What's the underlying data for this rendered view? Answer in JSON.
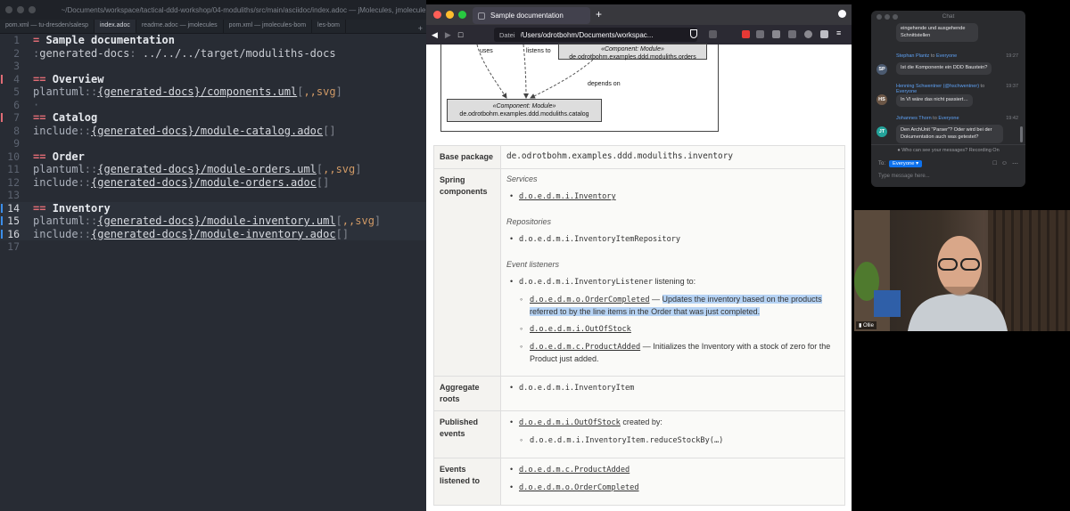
{
  "editor": {
    "window_title": "~/Documents/workspace/tactical-ddd-workshop/04-moduliths/src/main/asciidoc/index.adoc — jMolecules, jmolecule...",
    "tabs": [
      {
        "label": "pom.xml — tu-dresden/salesp",
        "active": false
      },
      {
        "label": "index.adoc",
        "active": true
      },
      {
        "label": "readme.adoc — jmolecules",
        "active": false
      },
      {
        "label": "pom.xml — jmolecules-bom",
        "active": false
      },
      {
        "label": "les-bom",
        "active": false
      }
    ],
    "plus": "+",
    "lines": [
      {
        "n": "1",
        "code": "heading",
        "marker": "",
        "text": "Sample documentation"
      },
      {
        "n": "2",
        "code": "attr",
        "marker": "",
        "name": "generated-docs",
        "value": "../../../target/moduliths-docs"
      },
      {
        "n": "3",
        "code": "blank",
        "marker": ""
      },
      {
        "n": "4",
        "code": "heading2",
        "marker": "#e06c75",
        "text": "Overview"
      },
      {
        "n": "5",
        "code": "macro",
        "marker": "",
        "kw": "plantuml",
        "path": "{generated-docs}/components.uml",
        "opts": ",,svg"
      },
      {
        "n": "6",
        "code": "blank",
        "marker": "",
        "dot": true
      },
      {
        "n": "7",
        "code": "heading2",
        "marker": "#e06c75",
        "text": "Catalog"
      },
      {
        "n": "8",
        "code": "macro",
        "marker": "",
        "kw": "include",
        "path": "{generated-docs}/module-catalog.adoc",
        "opts": ""
      },
      {
        "n": "9",
        "code": "blank",
        "marker": ""
      },
      {
        "n": "10",
        "code": "heading2",
        "marker": "",
        "text": "Order"
      },
      {
        "n": "11",
        "code": "macro",
        "marker": "",
        "kw": "plantuml",
        "path": "{generated-docs}/module-orders.uml",
        "opts": ",,svg"
      },
      {
        "n": "12",
        "code": "macro",
        "marker": "",
        "kw": "include",
        "path": "{generated-docs}/module-orders.adoc",
        "opts": ""
      },
      {
        "n": "13",
        "code": "blank",
        "marker": ""
      },
      {
        "n": "14",
        "code": "heading2",
        "marker": "#3b8eea",
        "text": "Inventory",
        "current": true
      },
      {
        "n": "15",
        "code": "macro",
        "marker": "#3b8eea",
        "kw": "plantuml",
        "path": "{generated-docs}/module-inventory.uml",
        "opts": ",,svg",
        "current": true
      },
      {
        "n": "16",
        "code": "macro",
        "marker": "#3b8eea",
        "kw": "include",
        "path": "{generated-docs}/module-inventory.adoc",
        "opts": "",
        "current": true
      },
      {
        "n": "17",
        "code": "blank",
        "marker": ""
      }
    ]
  },
  "browser": {
    "tab_title": "Sample documentation",
    "new_tab": "+",
    "url_protocol": "Datei",
    "url": "/Users/odrotbohm/Documents/workspac...",
    "diagram": {
      "edge_uses": "uses",
      "edge_listens": "listens to",
      "edge_depends": "depends on",
      "comp_orders_stereo": "«Component: Module»",
      "comp_orders_name": "de.odrotbohm.examples.ddd.moduliths.orders",
      "comp_catalog_stereo": "«Component: Module»",
      "comp_catalog_name": "de.odrotbohm.examples.ddd.moduliths.catalog"
    },
    "table": {
      "base_package_label": "Base package",
      "base_package_value": "de.odrotbohm.examples.ddd.moduliths.inventory",
      "spring_label": "Spring components",
      "services_heading": "Services",
      "services": [
        "d.o.e.d.m.i.Inventory"
      ],
      "repositories_heading": "Repositories",
      "repositories": [
        "d.o.e.d.m.i.InventoryItemRepository"
      ],
      "listeners_heading": "Event listeners",
      "listener_name": "d.o.e.d.m.i.InventoryListener",
      "listener_suffix": " listening to:",
      "listener_events": [
        {
          "name": "d.o.e.d.m.o.OrderCompleted",
          "desc": "Updates the inventory based on the products referred to by the line items in the Order that was just completed.",
          "highlight": true
        },
        {
          "name": "d.o.e.d.m.i.OutOfStock",
          "desc": "",
          "highlight": false
        },
        {
          "name": "d.o.e.d.m.c.ProductAdded",
          "desc": "Initializes the Inventory with a stock of zero for the Product just added.",
          "highlight": false
        }
      ],
      "aggregate_label": "Aggregate roots",
      "aggregate_value": "d.o.e.d.m.i.InventoryItem",
      "published_label": "Published events",
      "published_event": "d.o.e.d.m.i.OutOfStock",
      "published_suffix": " created by:",
      "published_source": "d.o.e.d.m.i.InventoryItem.reduceStockBy(…)",
      "listened_label": "Events listened to",
      "listened_events": [
        "d.o.e.d.m.c.ProductAdded",
        "d.o.e.d.m.o.OrderCompleted"
      ]
    }
  },
  "chat": {
    "title": "Chat",
    "messages": [
      {
        "initials": "",
        "avatar_color": "#5b5d62",
        "sender": "",
        "to": "",
        "recipient": "",
        "time": "",
        "text": "eingehende und ausgehende Schnittstellen"
      },
      {
        "initials": "SP",
        "avatar_color": "#4b5a70",
        "sender": "Stephan Plantz",
        "to": " to ",
        "recipient": "Everyone",
        "time": "19:27",
        "text": "Ist die Komponente ein DDD Baustein?"
      },
      {
        "initials": "HS",
        "avatar_color": "#6b5646",
        "sender": "Henning Schwentner (@hschwentner)",
        "to": " to ",
        "recipient": "Everyone",
        "time": "19:37",
        "text": "In VI wäre das nicht passiert…"
      },
      {
        "initials": "JT",
        "avatar_color": "#23a39a",
        "sender": "Johannes Thorn",
        "to": " to ",
        "recipient": "Everyone",
        "time": "19:42",
        "text": "Den ArchUnit \"Parser\"? Oder wird bei der Dokumentation auch was getestet?"
      }
    ],
    "notice": "Who can see your messages? Recording On",
    "to_label": "To:",
    "to_value": "Everyone",
    "input_placeholder": "Type message here..."
  },
  "webcam": {
    "name": "Ollie"
  }
}
